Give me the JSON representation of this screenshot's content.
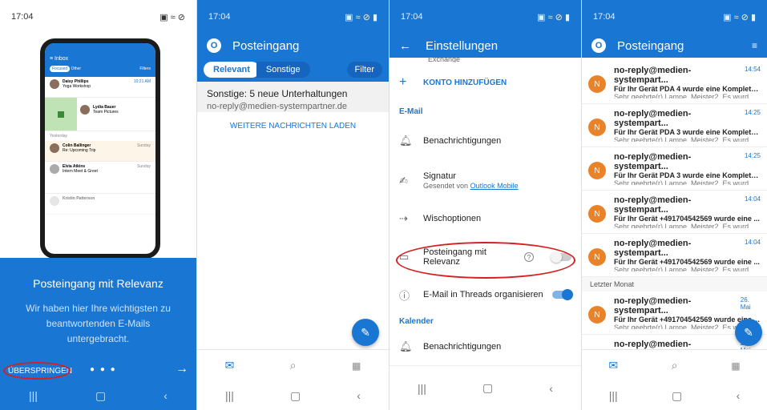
{
  "p1": {
    "status_time": "17:04",
    "phone": {
      "inbox": "Inbox",
      "focused": "Focused",
      "other": "Other",
      "filters": "Filters",
      "rows": [
        {
          "name": "Daisy Phillips",
          "subject": "Yoga Workshop",
          "time": "10:21 AM"
        },
        {
          "name": "Lydia Bauer",
          "subject": "Team Pictures",
          "time": ""
        },
        {
          "name": "Colin Ballinger",
          "subject": "Re: Upcoming Trip",
          "time": "Sunday"
        },
        {
          "name": "Elvia Atkins",
          "subject": "Intern Meet & Greet",
          "time": "Sunday"
        },
        {
          "name": "Kristin Patterson",
          "subject": "",
          "time": ""
        }
      ],
      "yesterday": "Yesterday"
    },
    "title": "Posteingang mit Relevanz",
    "text": "Wir haben hier Ihre wichtigsten zu beantwortenden E-Mails untergebracht.",
    "skip": "ÜBERSPRINGEN"
  },
  "p2": {
    "status_time": "17:04",
    "title": "Posteingang",
    "tab_relevant": "Relevant",
    "tab_other": "Sonstige",
    "filter": "Filter",
    "cluster_title": "Sonstige: 5 neue Unterhaltungen",
    "cluster_sender": "no-reply@medien-systempartner.de",
    "load_more": "WEITERE NACHRICHTEN LADEN"
  },
  "p3": {
    "status_time": "17:04",
    "title": "Einstellungen",
    "exchange": "Exchange",
    "add_account": "KONTO HINZUFÜGEN",
    "email_section": "E-Mail",
    "notifications": "Benachrichtigungen",
    "signature": "Signatur",
    "signature_sub": "Gesendet von",
    "signature_link": "Outlook Mobile",
    "swipe": "Wischoptionen",
    "focused_inbox": "Posteingang mit Relevanz",
    "threads": "E-Mail in Threads organisieren",
    "calendar_section": "Kalender",
    "cal_notifications": "Benachrichtigungen"
  },
  "p4": {
    "status_time": "17:04",
    "title": "Posteingang",
    "mails": [
      {
        "sender": "no-reply@medien-systempart...",
        "time": "14:54",
        "subject": "Für Ihr Gerät PDA 4 wurde eine Komplettl...",
        "preview": "Sehr geehrte(r) Lampe, Meister2, Es wurd..."
      },
      {
        "sender": "no-reply@medien-systempart...",
        "time": "14:25",
        "subject": "Für Ihr Gerät PDA 3 wurde eine Komplettl...",
        "preview": "Sehr geehrte(r) Lampe, Meister2, Es wurd..."
      },
      {
        "sender": "no-reply@medien-systempart...",
        "time": "14:25",
        "subject": "Für Ihr Gerät PDA 3 wurde eine Komplettl...",
        "preview": "Sehr geehrte(r) Lampe, Meister2, Es wurd..."
      },
      {
        "sender": "no-reply@medien-systempart...",
        "time": "14:04",
        "subject": "Für Ihr Gerät +491704542569 wurde eine ...",
        "preview": "Sehr geehrte(r) Lampe, Meister2, Es wurd..."
      },
      {
        "sender": "no-reply@medien-systempart...",
        "time": "14:04",
        "subject": "Für Ihr Gerät +491704542569 wurde eine ...",
        "preview": "Sehr geehrte(r) Lampe, Meister2, Es wurd..."
      }
    ],
    "last_month": "Letzter Monat",
    "mails2": [
      {
        "sender": "no-reply@medien-systempart...",
        "time": "26. Mai",
        "subject": "Für Ihr Gerät +491704542569 wurde eine ...",
        "preview": "Sehr geehrte(r) Lampe, Meister2, Es wurd..."
      },
      {
        "sender": "no-reply@medien-systempart...",
        "time": "26. Mai",
        "subject": "",
        "preview": ""
      }
    ],
    "avatar_letter": "N"
  },
  "colors": {
    "brand": "#1976d2",
    "avatar": "#e8832a",
    "highlight": "#d42020"
  }
}
